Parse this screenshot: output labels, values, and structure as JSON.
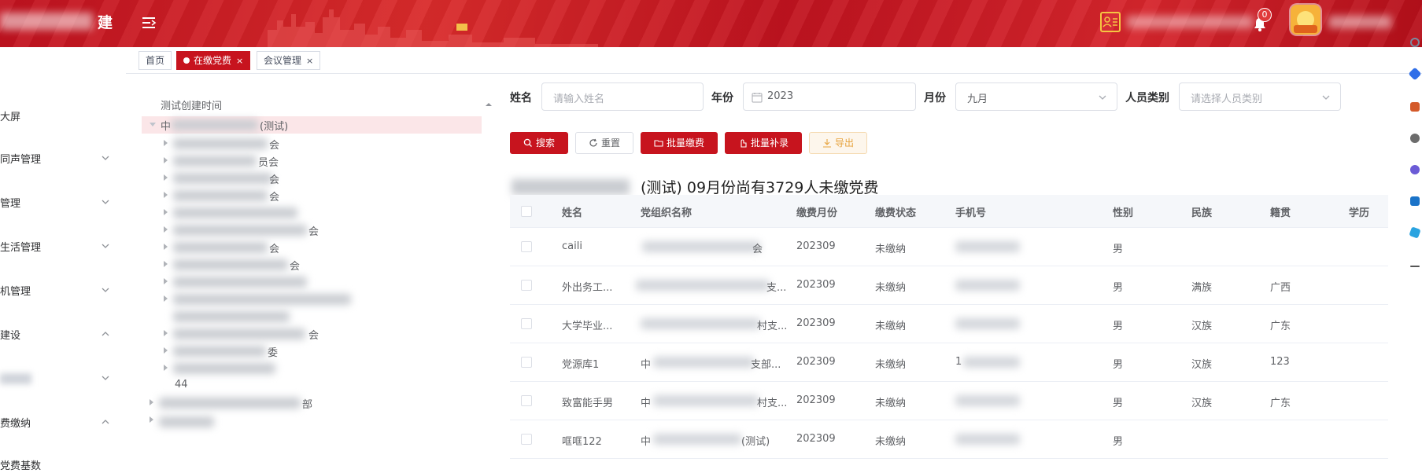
{
  "header": {
    "logo_tail": "建",
    "notification_count": "0"
  },
  "sidebar": {
    "items": [
      {
        "label": "大屏",
        "arrow": ""
      },
      {
        "label": "同声管理",
        "arrow": "down"
      },
      {
        "label": "管理",
        "arrow": "down"
      },
      {
        "label": "生活管理",
        "arrow": "down"
      },
      {
        "label": "机管理",
        "arrow": "down"
      },
      {
        "label": "建设",
        "arrow": "up"
      },
      {
        "label": "",
        "arrow": "down"
      },
      {
        "label": "费缴纳",
        "arrow": "up"
      },
      {
        "label": "党费基数",
        "arrow": ""
      }
    ]
  },
  "tabs": [
    {
      "label": "首页",
      "closable": false
    },
    {
      "label": "在缴党费",
      "closable": true,
      "active": true
    },
    {
      "label": "会议管理",
      "closable": true
    }
  ],
  "tree": {
    "title": "测试创建时间",
    "nodes": [
      {
        "text": "(测试)",
        "prefix": "中",
        "level": 0,
        "selected": true
      },
      {
        "text": "会",
        "level": 1
      },
      {
        "text": "员会",
        "level": 1
      },
      {
        "text": "会",
        "level": 1
      },
      {
        "text": "会",
        "level": 1
      },
      {
        "text": "",
        "level": 1
      },
      {
        "text": "会",
        "level": 1
      },
      {
        "text": "会",
        "level": 1
      },
      {
        "text": "会",
        "level": 1
      },
      {
        "text": "",
        "level": 1
      },
      {
        "text": "",
        "level": 1
      },
      {
        "text": "",
        "level": 1
      },
      {
        "text": "会",
        "level": 1
      },
      {
        "text": "委",
        "level": 1
      },
      {
        "text": "",
        "level": 1
      },
      {
        "text": "44",
        "level": 1
      },
      {
        "text": "部",
        "level": 0
      }
    ]
  },
  "form": {
    "name_label": "姓名",
    "name_placeholder": "请输入姓名",
    "year_label": "年份",
    "year_value": "2023",
    "month_label": "月份",
    "month_value": "九月",
    "type_label": "人员类别",
    "type_placeholder": "请选择人员类别"
  },
  "buttons": {
    "search": "搜索",
    "reset": "重置",
    "batch_pay": "批量缴费",
    "batch_supplement": "批量补录",
    "export": "导出"
  },
  "summary": "(测试)  09月份尚有3729人未缴党费",
  "table": {
    "columns": [
      "姓名",
      "党组织名称",
      "缴费月份",
      "缴费状态",
      "手机号",
      "性别",
      "民族",
      "籍贯",
      "学历"
    ],
    "rows": [
      {
        "name": "caili",
        "org_tail": "会",
        "month": "202309",
        "status": "未缴纳",
        "phone_prefix": "",
        "gender": "男",
        "ethnicity": "",
        "native": ""
      },
      {
        "name": "外出务工...",
        "org_tail": "支...",
        "month": "202309",
        "status": "未缴纳",
        "phone_prefix": "",
        "gender": "男",
        "ethnicity": "满族",
        "native": "广西"
      },
      {
        "name": "大学毕业...",
        "org_tail": "村支...",
        "month": "202309",
        "status": "未缴纳",
        "phone_prefix": "",
        "gender": "男",
        "ethnicity": "汉族",
        "native": "广东"
      },
      {
        "name": "党源库1",
        "org_prefix": "中",
        "org_tail": "支部...",
        "month": "202309",
        "status": "未缴纳",
        "phone_prefix": "1",
        "gender": "男",
        "ethnicity": "汉族",
        "native": "123"
      },
      {
        "name": "致富能手男",
        "org_prefix": "中",
        "org_tail": "村支...",
        "month": "202309",
        "status": "未缴纳",
        "phone_prefix": "",
        "gender": "男",
        "ethnicity": "汉族",
        "native": "广东"
      },
      {
        "name": "哐哐122",
        "org_prefix": "中",
        "org_tail": "(测试)",
        "month": "202309",
        "status": "未缴纳",
        "phone_prefix": "",
        "gender": "男",
        "ethnicity": "",
        "native": ""
      }
    ]
  },
  "colors": {
    "brand_red": "#c7141e",
    "header_red": "#d12a2a",
    "warning": "#e6a23c"
  }
}
